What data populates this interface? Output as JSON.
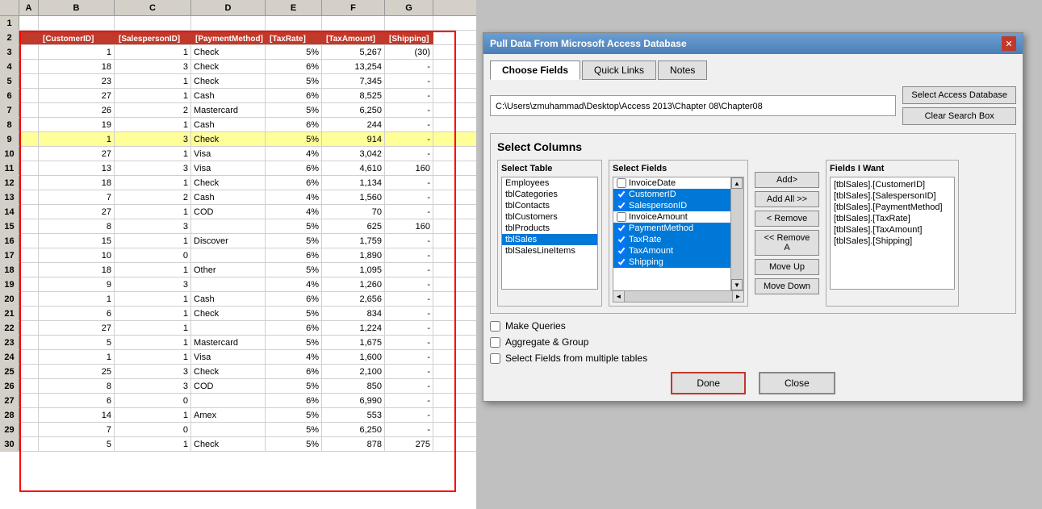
{
  "dialog": {
    "title": "Pull Data From Microsoft Access Database",
    "tabs": [
      "Choose Fields",
      "Quick Links",
      "Notes"
    ],
    "active_tab": "Choose Fields",
    "filepath": "C:\\Users\\zmuhammad\\Desktop\\Access 2013\\Chapter 08\\Chapter08",
    "buttons": {
      "select_db": "Select Access Database",
      "clear_search": "Clear Search Box"
    },
    "section_title": "Select Columns",
    "select_table": {
      "label": "Select Table",
      "items": [
        "Employees",
        "tblCategories",
        "tblContacts",
        "tblCustomers",
        "tblProducts",
        "tblSales",
        "tblSalesLineItems"
      ],
      "selected": "tblSales"
    },
    "select_fields": {
      "label": "Select Fields",
      "items": [
        {
          "name": "InvoiceDate",
          "checked": false,
          "selected": false
        },
        {
          "name": "CustomerID",
          "checked": true,
          "selected": true
        },
        {
          "name": "SalespersonID",
          "checked": true,
          "selected": true
        },
        {
          "name": "InvoiceAmount",
          "checked": false,
          "selected": false
        },
        {
          "name": "PaymentMethod",
          "checked": true,
          "selected": true
        },
        {
          "name": "TaxRate",
          "checked": true,
          "selected": true
        },
        {
          "name": "TaxAmount",
          "checked": true,
          "selected": true
        },
        {
          "name": "Shipping",
          "checked": true,
          "selected": true
        }
      ]
    },
    "mid_buttons": [
      "Add>",
      "Add All >>",
      "< Remove",
      "<< Remove A",
      "Move Up",
      "Move Down"
    ],
    "fields_i_want": {
      "label": "Fields I Want",
      "items": [
        "[tblSales].[CustomerID]",
        "[tblSales].[SalespersonID]",
        "[tblSales].[PaymentMethod]",
        "[tblSales].[TaxRate]",
        "[tblSales].[TaxAmount]",
        "[tblSales].[Shipping]"
      ]
    },
    "checkboxes": [
      {
        "label": "Make Queries",
        "checked": false
      },
      {
        "label": "Aggregate & Group",
        "checked": false
      },
      {
        "label": "Select Fields from multiple tables",
        "checked": false
      }
    ],
    "bottom_buttons": [
      "Done",
      "Close"
    ]
  },
  "spreadsheet": {
    "col_headers": [
      "A",
      "B",
      "C",
      "D",
      "E",
      "F",
      "G"
    ],
    "header_row": [
      "[CustomerID]",
      "[SalespersonID]",
      "[PaymentMethod]",
      "[TaxRate]",
      "[TaxAmount]",
      "[Shipping]"
    ],
    "rows": [
      {
        "num": 3,
        "a": "1",
        "b": "1",
        "c": "Check",
        "d": "5%",
        "e": "5,267",
        "f": "(30)"
      },
      {
        "num": 4,
        "a": "18",
        "b": "3",
        "c": "Check",
        "d": "6%",
        "e": "13,254",
        "f": "-"
      },
      {
        "num": 5,
        "a": "23",
        "b": "1",
        "c": "Check",
        "d": "5%",
        "e": "7,345",
        "f": "-"
      },
      {
        "num": 6,
        "a": "27",
        "b": "1",
        "c": "Cash",
        "d": "6%",
        "e": "8,525",
        "f": "-"
      },
      {
        "num": 7,
        "a": "26",
        "b": "2",
        "c": "Mastercard",
        "d": "5%",
        "e": "6,250",
        "f": "-"
      },
      {
        "num": 8,
        "a": "19",
        "b": "1",
        "c": "Cash",
        "d": "6%",
        "e": "244",
        "f": "-"
      },
      {
        "num": 9,
        "a": "1",
        "b": "3",
        "c": "Check",
        "d": "5%",
        "e": "914",
        "f": "-",
        "highlight": true
      },
      {
        "num": 10,
        "a": "27",
        "b": "1",
        "c": "Visa",
        "d": "4%",
        "e": "3,042",
        "f": "-"
      },
      {
        "num": 11,
        "a": "13",
        "b": "3",
        "c": "Visa",
        "d": "6%",
        "e": "4,610",
        "f": "160"
      },
      {
        "num": 12,
        "a": "18",
        "b": "1",
        "c": "Check",
        "d": "6%",
        "e": "1,134",
        "f": "-"
      },
      {
        "num": 13,
        "a": "7",
        "b": "2",
        "c": "Cash",
        "d": "4%",
        "e": "1,560",
        "f": "-"
      },
      {
        "num": 14,
        "a": "27",
        "b": "1",
        "c": "COD",
        "d": "4%",
        "e": "70",
        "f": "-"
      },
      {
        "num": 15,
        "a": "8",
        "b": "3",
        "c": "",
        "d": "5%",
        "e": "625",
        "f": "160"
      },
      {
        "num": 16,
        "a": "15",
        "b": "1",
        "c": "Discover",
        "d": "5%",
        "e": "1,759",
        "f": "-"
      },
      {
        "num": 17,
        "a": "10",
        "b": "0",
        "c": "",
        "d": "6%",
        "e": "1,890",
        "f": "-"
      },
      {
        "num": 18,
        "a": "18",
        "b": "1",
        "c": "Other",
        "d": "5%",
        "e": "1,095",
        "f": "-"
      },
      {
        "num": 19,
        "a": "9",
        "b": "3",
        "c": "",
        "d": "4%",
        "e": "1,260",
        "f": "-"
      },
      {
        "num": 20,
        "a": "1",
        "b": "1",
        "c": "Cash",
        "d": "6%",
        "e": "2,656",
        "f": "-"
      },
      {
        "num": 21,
        "a": "6",
        "b": "1",
        "c": "Check",
        "d": "5%",
        "e": "834",
        "f": "-"
      },
      {
        "num": 22,
        "a": "27",
        "b": "1",
        "c": "",
        "d": "6%",
        "e": "1,224",
        "f": "-"
      },
      {
        "num": 23,
        "a": "5",
        "b": "1",
        "c": "Mastercard",
        "d": "5%",
        "e": "1,675",
        "f": "-"
      },
      {
        "num": 24,
        "a": "1",
        "b": "1",
        "c": "Visa",
        "d": "4%",
        "e": "1,600",
        "f": "-"
      },
      {
        "num": 25,
        "a": "25",
        "b": "3",
        "c": "Check",
        "d": "6%",
        "e": "2,100",
        "f": "-"
      },
      {
        "num": 26,
        "a": "8",
        "b": "3",
        "c": "COD",
        "d": "5%",
        "e": "850",
        "f": "-"
      },
      {
        "num": 27,
        "a": "6",
        "b": "0",
        "c": "",
        "d": "6%",
        "e": "6,990",
        "f": "-"
      },
      {
        "num": 28,
        "a": "14",
        "b": "1",
        "c": "Amex",
        "d": "5%",
        "e": "553",
        "f": "-"
      },
      {
        "num": 29,
        "a": "7",
        "b": "0",
        "c": "",
        "d": "5%",
        "e": "6,250",
        "f": "-"
      },
      {
        "num": 30,
        "a": "5",
        "b": "1",
        "c": "Check",
        "d": "5%",
        "e": "878",
        "f": "275"
      }
    ]
  }
}
